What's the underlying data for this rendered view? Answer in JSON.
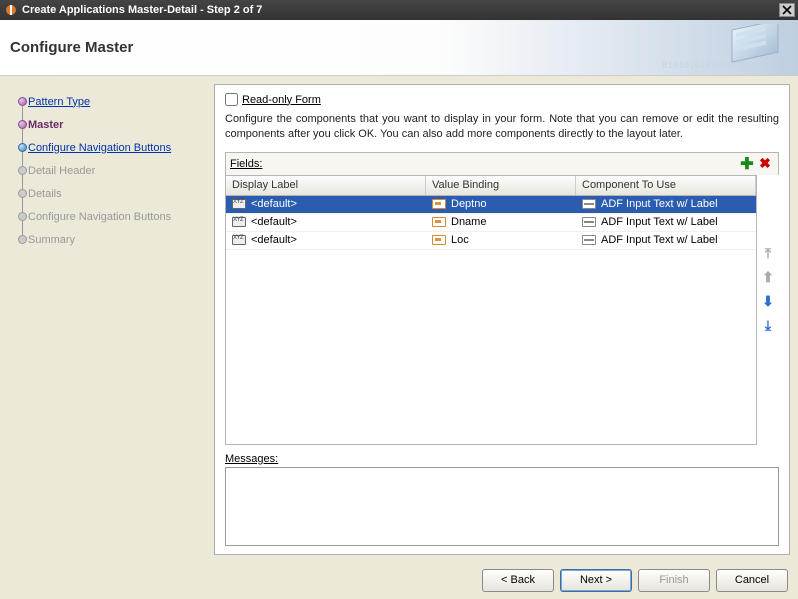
{
  "titlebar": {
    "title": "Create Applications Master-Detail - Step 2 of 7"
  },
  "header": {
    "title": "Configure Master"
  },
  "nav": {
    "items": [
      {
        "label": "Pattern Type",
        "state": "done",
        "link": true
      },
      {
        "label": "Master",
        "state": "active",
        "link": false
      },
      {
        "label": "Configure Navigation Buttons",
        "state": "current",
        "link": true
      },
      {
        "label": "Detail Header",
        "state": "future",
        "link": false
      },
      {
        "label": "Details",
        "state": "future",
        "link": false
      },
      {
        "label": "Configure Navigation Buttons",
        "state": "future",
        "link": false
      },
      {
        "label": "Summary",
        "state": "future",
        "link": false
      }
    ]
  },
  "panel": {
    "readonly_label": "Read-only Form",
    "readonly_checked": false,
    "description": "Configure the components that you want to display in your form.  Note that you can remove or edit the resulting components after you click OK.  You can also add more components directly to the layout later.",
    "fields_label": "Fields:",
    "columns": {
      "display": "Display Label",
      "binding": "Value Binding",
      "component": "Component To Use"
    },
    "rows": [
      {
        "display": "<default>",
        "binding": "Deptno",
        "component": "ADF Input Text w/ Label",
        "selected": true
      },
      {
        "display": "<default>",
        "binding": "Dname",
        "component": "ADF Input Text w/ Label",
        "selected": false
      },
      {
        "display": "<default>",
        "binding": "Loc",
        "component": "ADF Input Text w/ Label",
        "selected": false
      }
    ],
    "messages_label": "Messages:"
  },
  "footer": {
    "back": "< Back",
    "next": "Next >",
    "finish": "Finish",
    "cancel": "Cancel"
  }
}
